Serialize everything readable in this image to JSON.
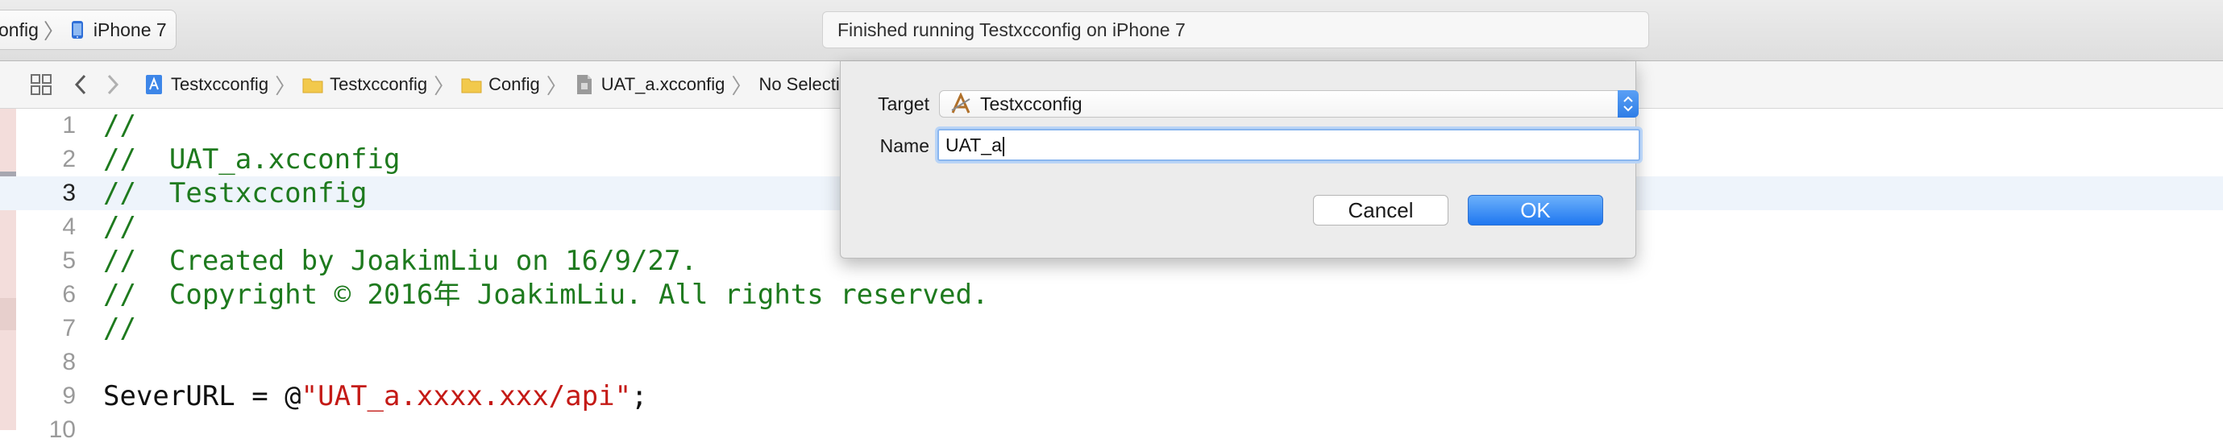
{
  "toolbar": {
    "scheme_partial": "onfig",
    "device": "iPhone 7",
    "activity_status": "Finished running Testxcconfig on iPhone 7"
  },
  "jumpbar": {
    "breadcrumbs": [
      "Testxcconfig",
      "Testxcconfig",
      "Config",
      "UAT_a.xcconfig",
      "No Selecti"
    ],
    "icons": [
      "grid-icon",
      "back-chevron-icon",
      "forward-chevron-icon",
      "project-icon",
      "folder-icon",
      "folder-icon",
      "xcconfig-file-icon"
    ]
  },
  "editor": {
    "current_line": 3,
    "lines": [
      {
        "num": "1",
        "text": "//"
      },
      {
        "num": "2",
        "text": "//  UAT_a.xcconfig"
      },
      {
        "num": "3",
        "text": "//  Testxcconfig"
      },
      {
        "num": "4",
        "text": "//"
      },
      {
        "num": "5",
        "text": "//  Created by JoakimLiu on 16/9/27."
      },
      {
        "num": "6",
        "text": "//  Copyright © 2016年 JoakimLiu. All rights reserved."
      },
      {
        "num": "7",
        "text": "//"
      },
      {
        "num": "8",
        "text": ""
      },
      {
        "num": "9",
        "prefix": "SeverURL = @",
        "string": "\"UAT_a.xxxx.xxx/api\"",
        "suffix": ";"
      },
      {
        "num": "10",
        "text": ""
      }
    ]
  },
  "dialog": {
    "target_label": "Target",
    "target_value": "Testxcconfig",
    "name_label": "Name",
    "name_value": "UAT_a",
    "cancel_label": "Cancel",
    "ok_label": "OK"
  },
  "colors": {
    "comment": "#1e7a1e",
    "string": "#c41a16",
    "accent": "#1f77f0"
  }
}
